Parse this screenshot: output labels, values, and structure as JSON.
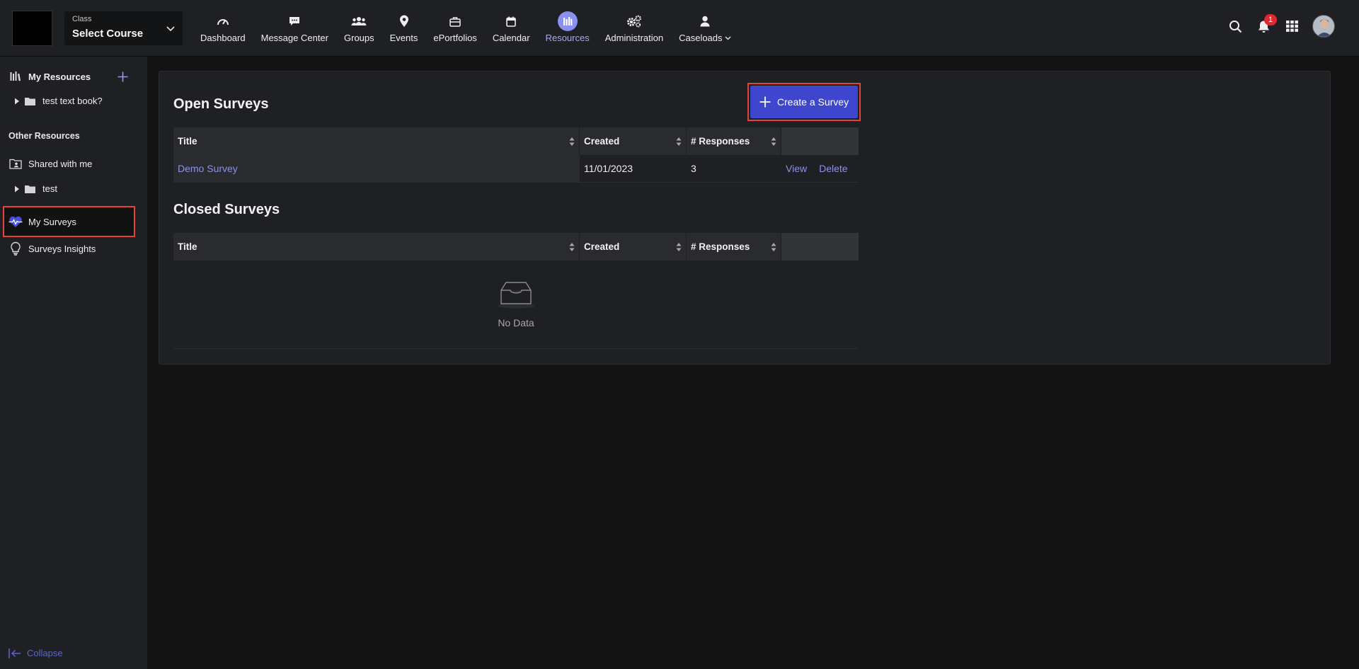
{
  "header": {
    "class_label": "Class",
    "class_value": "Select Course",
    "nav": [
      {
        "label": "Dashboard",
        "icon": "dashboard-icon"
      },
      {
        "label": "Message Center",
        "icon": "message-icon"
      },
      {
        "label": "Groups",
        "icon": "groups-icon"
      },
      {
        "label": "Events",
        "icon": "location-pin-icon"
      },
      {
        "label": "ePortfolios",
        "icon": "briefcase-icon"
      },
      {
        "label": "Calendar",
        "icon": "calendar-icon"
      },
      {
        "label": "Resources",
        "icon": "resources-icon",
        "active": true
      },
      {
        "label": "Administration",
        "icon": "gears-icon"
      },
      {
        "label": "Caseloads",
        "icon": "user-icon",
        "dropdown": true
      }
    ],
    "notification_count": "1"
  },
  "sidebar": {
    "my_resources": "My Resources",
    "my_resources_items": [
      {
        "label": "test text book?"
      }
    ],
    "other_resources_heading": "Other Resources",
    "shared_with_me": "Shared with me",
    "shared_items": [
      {
        "label": "test"
      }
    ],
    "my_surveys": "My Surveys",
    "surveys_insights": "Surveys Insights",
    "collapse": "Collapse"
  },
  "main": {
    "create_button": "Create a Survey",
    "open_surveys": {
      "title": "Open Surveys",
      "columns": [
        "Title",
        "Created",
        "# Responses"
      ],
      "rows": [
        {
          "title": "Demo Survey",
          "created": "11/01/2023",
          "responses": "3",
          "actions": [
            "View",
            "Delete"
          ]
        }
      ]
    },
    "closed_surveys": {
      "title": "Closed Surveys",
      "columns": [
        "Title",
        "Created",
        "# Responses"
      ],
      "empty_text": "No Data"
    }
  },
  "colors": {
    "accent": "#3d46cc",
    "link": "#8d92e8",
    "highlight": "#e2443a",
    "background": "#141414",
    "panel": "#1f2023"
  }
}
